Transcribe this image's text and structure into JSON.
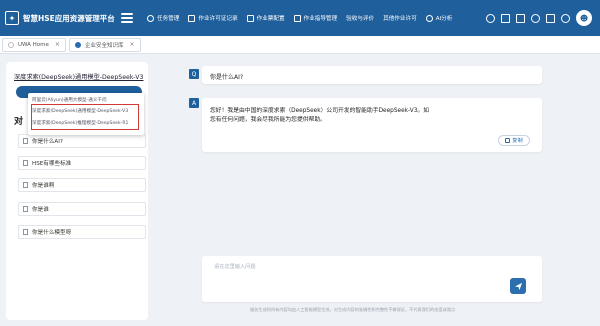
{
  "header": {
    "title": "智慧HSE应用资源管理平台",
    "nav": [
      {
        "label": "任务管理",
        "icon": "task-icon"
      },
      {
        "label": "作业许可证记录",
        "icon": "document-icon"
      },
      {
        "label": "作业票配置",
        "icon": "config-icon"
      },
      {
        "label": "作业指导管理",
        "icon": "guide-icon"
      },
      {
        "label": "验收与评价",
        "icon": "evaluate-icon"
      },
      {
        "label": "其他作业许可",
        "icon": "other-icon"
      },
      {
        "label": "AI分析",
        "icon": "ai-icon"
      }
    ]
  },
  "tabs": [
    {
      "label": "UWA Home"
    },
    {
      "label": "企业安全知识库"
    }
  ],
  "left": {
    "model_title": "深度求索(DeepSeek)通用模型-DeepSeek-V3",
    "dropdown": [
      "阿里云(Aliyun)通用大模型-通义千问",
      "深度求索(DeepSeek)通用模型-DeepSeek-V3",
      "深度求索(DeepSeek)推理模型-DeepSeek-R1"
    ],
    "list_heading": "对",
    "chats": [
      "你是什么AI?",
      "HSE有哪些标准",
      "你是谁啊",
      "你是谁",
      "你是什么模型呀"
    ]
  },
  "messages": {
    "q_badge": "Q",
    "a_badge": "A",
    "question": "你是什么AI?",
    "answer": "您好！我是由中国的深度求索（DeepSeek）公司开发的智能助手DeepSeek-V3。如您有任何问题，我会尽我所能为您提供帮助。",
    "copy_label": "复制"
  },
  "input": {
    "placeholder": "请在这里输入问题"
  },
  "footer_note": "服务生成的所有内容均由人工智能模型生成，对生成内容的准确性和完整性不做保证，不代表我们的态度或观点"
}
